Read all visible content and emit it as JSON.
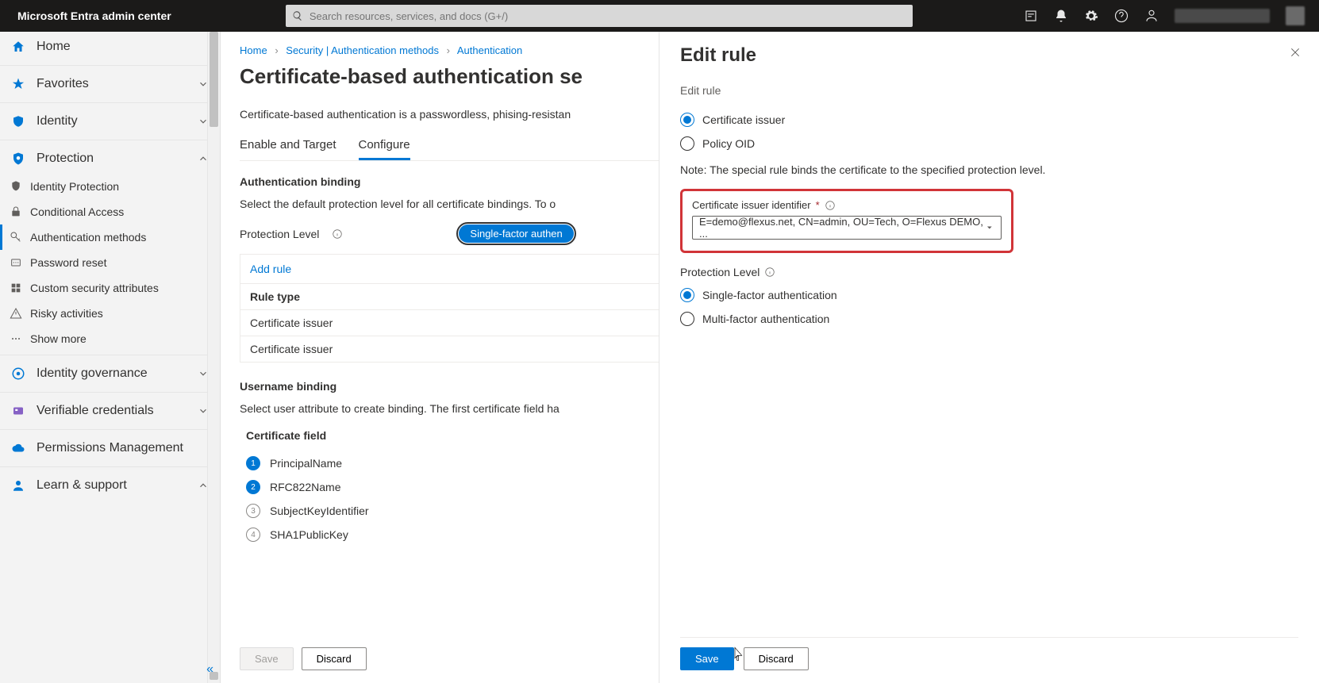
{
  "header": {
    "brand": "Microsoft Entra admin center",
    "search_placeholder": "Search resources, services, and docs (G+/)"
  },
  "sidebar": {
    "home": "Home",
    "favorites": "Favorites",
    "identity": "Identity",
    "protection": "Protection",
    "protection_children": {
      "identity_protection": "Identity Protection",
      "conditional_access": "Conditional Access",
      "auth_methods": "Authentication methods",
      "password_reset": "Password reset",
      "custom_sec": "Custom security attributes",
      "risky": "Risky activities",
      "show_more": "Show more"
    },
    "identity_governance": "Identity governance",
    "verifiable_credentials": "Verifiable credentials",
    "permissions_management": "Permissions Management",
    "learn_support": "Learn & support"
  },
  "breadcrumb": {
    "home": "Home",
    "security": "Security | Authentication methods",
    "auth": "Authentication"
  },
  "main": {
    "page_title": "Certificate-based authentication se",
    "intro": "Certificate-based authentication is a passwordless, phising-resistan",
    "tabs": {
      "enable": "Enable and Target",
      "configure": "Configure"
    },
    "auth_binding_title": "Authentication binding",
    "auth_binding_desc": "Select the default protection level for all certificate bindings. To o",
    "protection_level_label": "Protection Level",
    "pill_label": "Single-factor authen",
    "add_rule": "Add rule",
    "rule_type": "Rule type",
    "cert_issuer_1": "Certificate issuer",
    "cert_issuer_2": "Certificate issuer",
    "username_binding_title": "Username binding",
    "username_binding_desc": "Select user attribute to create binding. The first certificate field ha",
    "cert_field_header": "Certificate field",
    "cert_fields": {
      "f1": "PrincipalName",
      "f2": "RFC822Name",
      "f3": "SubjectKeyIdentifier",
      "f4": "SHA1PublicKey"
    },
    "save": "Save",
    "discard": "Discard"
  },
  "panel": {
    "title": "Edit rule",
    "sub_label": "Edit rule",
    "radio_cert_issuer": "Certificate issuer",
    "radio_policy_oid": "Policy OID",
    "note": "Note: The special rule binds the certificate to the specified protection level.",
    "identifier_label": "Certificate issuer identifier",
    "identifier_value": "E=demo@flexus.net, CN=admin, OU=Tech, O=Flexus DEMO, ...",
    "protection_level_label": "Protection Level",
    "radio_single": "Single-factor authentication",
    "radio_multi": "Multi-factor authentication",
    "save": "Save",
    "discard": "Discard"
  }
}
